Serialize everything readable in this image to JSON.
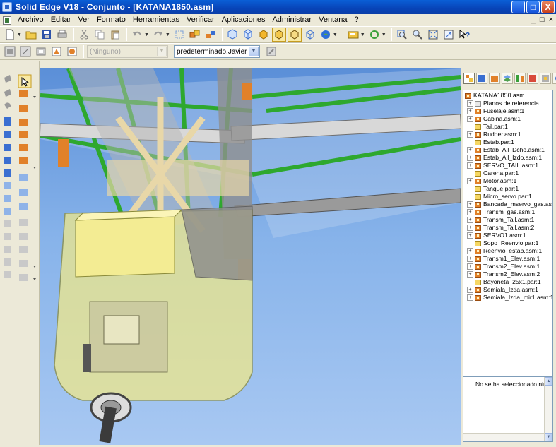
{
  "window": {
    "title": "Solid Edge V18 - Conjunto - [KATANA1850.asm]",
    "minimize": "_",
    "maximize": "□",
    "close": "X"
  },
  "menubar": {
    "items": [
      "Archivo",
      "Editar",
      "Ver",
      "Formato",
      "Herramientas",
      "Verificar",
      "Aplicaciones",
      "Administrar",
      "Ventana",
      "?"
    ],
    "mdi_controls": [
      "_",
      "□",
      "×"
    ]
  },
  "toolbar2": {
    "layer_combo": "(Ninguno)",
    "style_combo": "predeterminado.Javier"
  },
  "assembly_tree": {
    "root": "KATANA1850.asm",
    "items": [
      {
        "label": "Planos de referencia",
        "type": "ref",
        "expandable": true
      },
      {
        "label": "Fuselaje.asm:1",
        "type": "asm",
        "expandable": true
      },
      {
        "label": "Cabina.asm:1",
        "type": "asm",
        "expandable": true
      },
      {
        "label": "Tail.par:1",
        "type": "par",
        "expandable": false
      },
      {
        "label": "Rudder.asm:1",
        "type": "asm",
        "expandable": true
      },
      {
        "label": "Estab.par:1",
        "type": "par",
        "expandable": false
      },
      {
        "label": "Estab_Ail_Dcho.asm:1",
        "type": "asm",
        "expandable": true
      },
      {
        "label": "Estab_Ail_Izdo.asm:1",
        "type": "asm",
        "expandable": true
      },
      {
        "label": "SERVO_TAIL.asm:1",
        "type": "asm",
        "expandable": true
      },
      {
        "label": "Carena.par:1",
        "type": "par",
        "expandable": false
      },
      {
        "label": "Motor.asm:1",
        "type": "asm",
        "expandable": true
      },
      {
        "label": "Tanque.par:1",
        "type": "par",
        "expandable": false
      },
      {
        "label": "Micro_servo.par:1",
        "type": "par",
        "expandable": false
      },
      {
        "label": "Bancada_mservo_gas.as",
        "type": "asm",
        "expandable": true
      },
      {
        "label": "Transm_gas.asm:1",
        "type": "asm",
        "expandable": true
      },
      {
        "label": "Transm_Tail.asm:1",
        "type": "asm",
        "expandable": true
      },
      {
        "label": "Transm_Tail.asm:2",
        "type": "asm",
        "expandable": true
      },
      {
        "label": "SERVO1.asm:1",
        "type": "asm",
        "expandable": true
      },
      {
        "label": "Sopo_Reenvio.par:1",
        "type": "par",
        "expandable": false
      },
      {
        "label": "Reenvio_estab.asm:1",
        "type": "asm",
        "expandable": true
      },
      {
        "label": "Transm1_Elev.asm:1",
        "type": "asm",
        "expandable": true
      },
      {
        "label": "Transm2_Elev.asm:1",
        "type": "asm",
        "expandable": true
      },
      {
        "label": "Transm2_Elev.asm:2",
        "type": "asm",
        "expandable": true
      },
      {
        "label": "Bayoneta_25x1.par:1",
        "type": "par",
        "expandable": false
      },
      {
        "label": "Semiala_Izda.asm:1",
        "type": "asm",
        "expandable": true
      },
      {
        "label": "Semiala_Izda_mir1.asm:1",
        "type": "asm",
        "expandable": true
      }
    ]
  },
  "selection_panel": {
    "message": "No se ha seleccionado ningu"
  },
  "colors": {
    "viewport_sky": "#87b3ea",
    "frame_green": "#2ea82e",
    "cowl_yellow": "#efe88a",
    "part_tan": "#e8d7a8",
    "spar_grey": "#c8c8c8"
  }
}
